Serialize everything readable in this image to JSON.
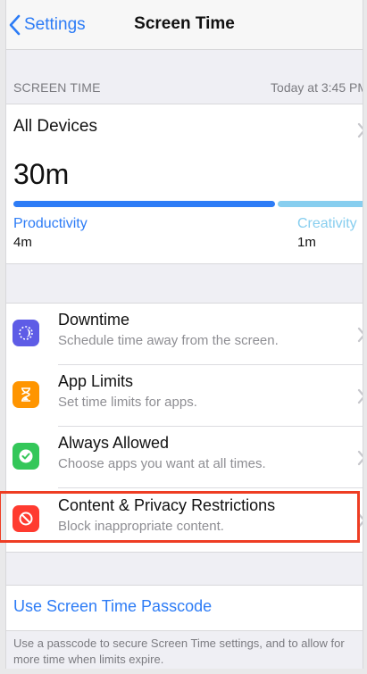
{
  "nav": {
    "back_label": "Settings",
    "title": "Screen Time"
  },
  "summary": {
    "section_label": "SCREEN TIME",
    "timestamp": "Today at 3:45 PM",
    "devices_label": "All Devices",
    "total": "30m",
    "categories": [
      {
        "name": "Productivity",
        "value": "4m",
        "color": "#2d7cf6"
      },
      {
        "name": "Creativity",
        "value": "1m",
        "color": "#87ceef"
      }
    ]
  },
  "settings": [
    {
      "title": "Downtime",
      "subtitle": "Schedule time away from the screen.",
      "icon": "downtime-icon",
      "color": "#5e5ce6"
    },
    {
      "title": "App Limits",
      "subtitle": "Set time limits for apps.",
      "icon": "hourglass-icon",
      "color": "#ff9500"
    },
    {
      "title": "Always Allowed",
      "subtitle": "Choose apps you want at all times.",
      "icon": "checkmark-badge-icon",
      "color": "#34c759"
    },
    {
      "title": "Content & Privacy Restrictions",
      "subtitle": "Block inappropriate content.",
      "icon": "prohibited-icon",
      "color": "#ff3b30"
    }
  ],
  "passcode": {
    "label": "Use Screen Time Passcode",
    "footer": "Use a passcode to secure Screen Time settings, and to allow for more time when limits expire."
  },
  "colors": {
    "accent": "#2d7cf6",
    "highlight": "#ee3d23"
  }
}
